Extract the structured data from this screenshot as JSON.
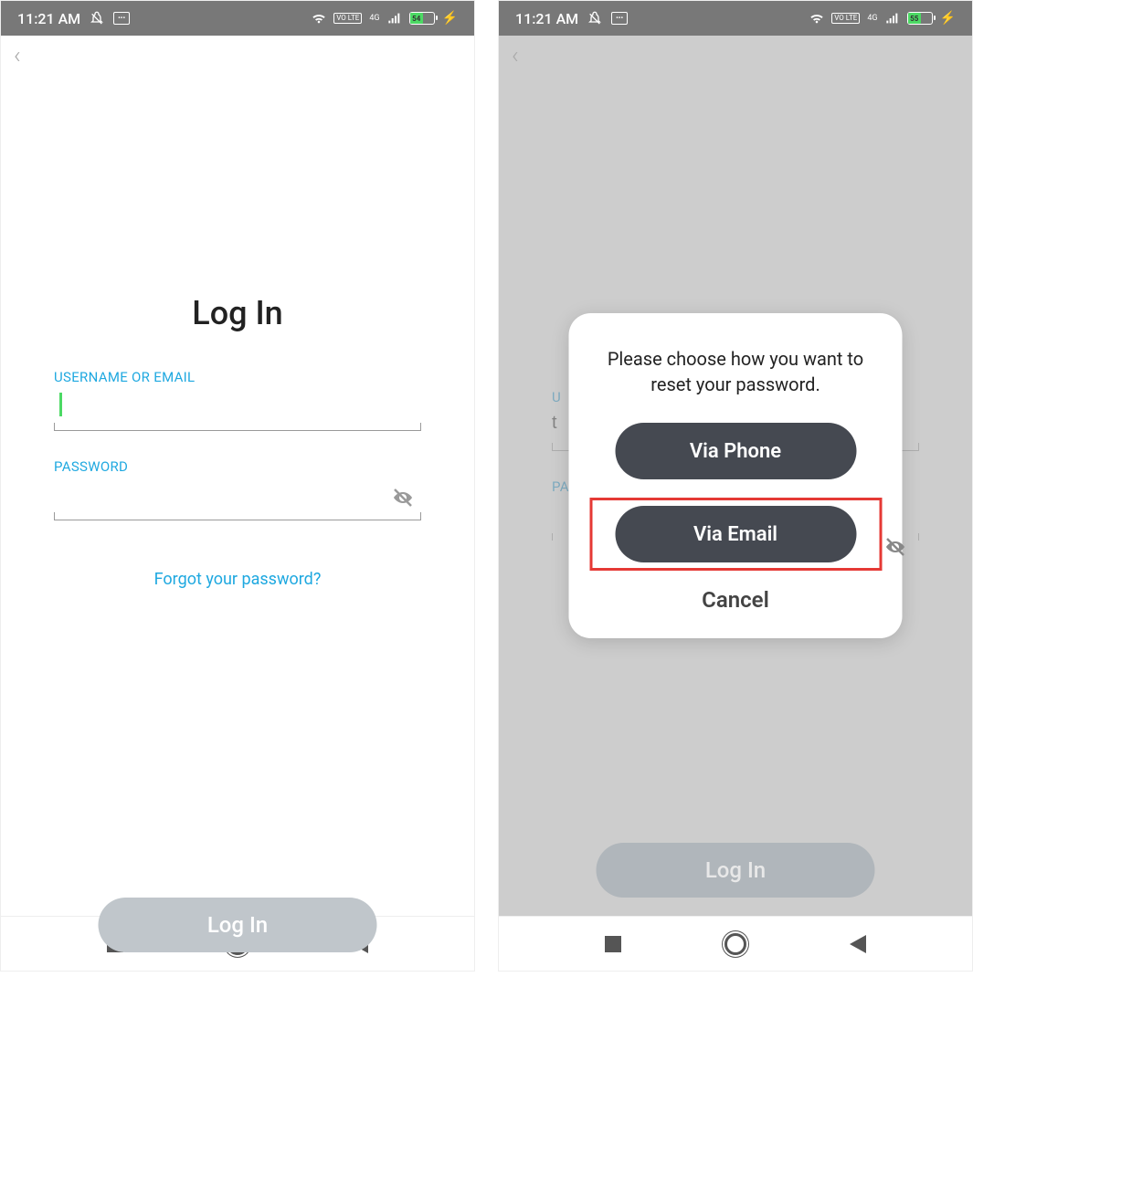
{
  "screen1": {
    "statusBar": {
      "time": "11:21 AM",
      "voLabel": "VO LTE",
      "netLabel": "4G",
      "battery": "54"
    },
    "title": "Log In",
    "usernameLabel": "USERNAME OR EMAIL",
    "passwordLabel": "PASSWORD",
    "forgotLink": "Forgot your password?",
    "loginButton": "Log In"
  },
  "screen2": {
    "statusBar": {
      "time": "11:21 AM",
      "voLabel": "VO LTE",
      "netLabel": "4G",
      "battery": "55"
    },
    "usernameValue": "t",
    "usernameLabel": "U",
    "passwordLabel": "PA",
    "loginButton": "Log In",
    "modal": {
      "message": "Please choose how you want to reset your password.",
      "viaPhone": "Via Phone",
      "viaEmail": "Via Email",
      "cancel": "Cancel"
    }
  }
}
